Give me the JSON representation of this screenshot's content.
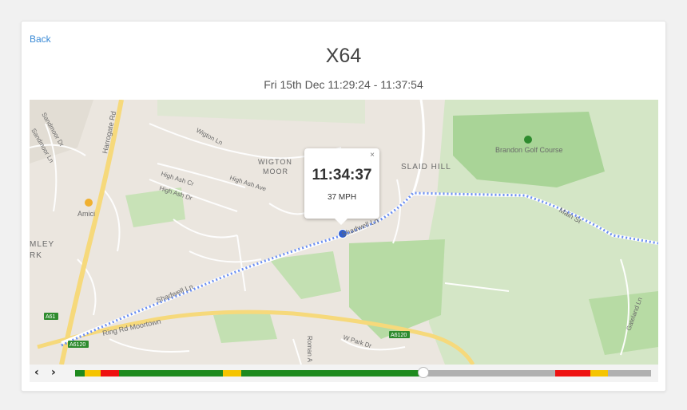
{
  "back_label": "Back",
  "title": "X64",
  "subtitle": "Fri 15th Dec 11:29:24 - 11:37:54",
  "popup": {
    "close": "×",
    "time": "11:34:37",
    "speed": "37 MPH"
  },
  "map_labels": {
    "harrogate_rd": "Harrogate Rd",
    "sandmoor_dr": "Sandmoor Dr",
    "sandmoor_ln": "Sandmoor Ln",
    "wigton_ln": "Wigton Ln",
    "wigton_moor_1": "WIGTON",
    "wigton_moor_2": "MOOR",
    "high_ash_ave": "High Ash Ave",
    "high_ash_cr": "High Ash Cr",
    "high_ash_dr": "High Ash Dr",
    "slaid_hill": "SLAID HILL",
    "brandon_golf": "Brandon Golf Course",
    "amici": "Amici",
    "mley": "MLEY",
    "rk": "RK",
    "shadwell_ln_1": "Shadwell Ln",
    "shadwell_ln_2": "Shadwell Ln",
    "main_st": "Main St",
    "ring_rd": "Ring Rd Moortown",
    "a61": "A61",
    "a6120_left": "A6120",
    "a6120_right": "A6120",
    "w_park_dr": "W Park Dr",
    "roman": "Roman A",
    "gateland_ln": "Gateland Ln"
  },
  "controls": {
    "prev": "‹",
    "next": "›"
  },
  "colors": {
    "green": "#1e8a1e",
    "yellow": "#f5c400",
    "red": "#ee1111",
    "gray": "#b0b0b0",
    "route": "#6b8ff2",
    "link": "#3a8ad6"
  }
}
